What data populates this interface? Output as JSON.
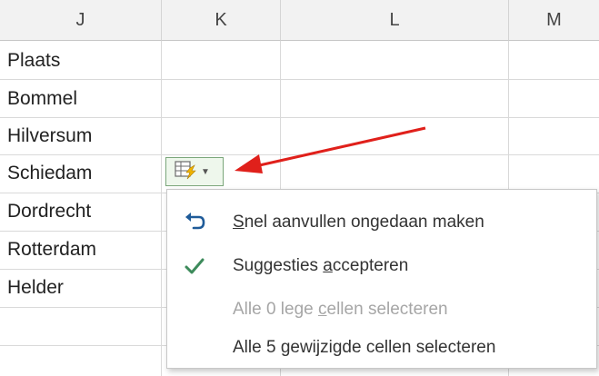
{
  "columns": [
    {
      "label": "J"
    },
    {
      "label": "K"
    },
    {
      "label": "L"
    },
    {
      "label": "M"
    }
  ],
  "column_j_values": [
    "Plaats",
    "Bommel",
    "Hilversum",
    "Schiedam",
    "Dordrecht",
    "Rotterdam",
    "Helder"
  ],
  "smart_tag": {
    "icon": "flash-fill-icon",
    "border_color": "#7aa67a"
  },
  "arrow": {
    "color": "#e0201b"
  },
  "menu": {
    "items": [
      {
        "prefix": "",
        "accel": "S",
        "suffix": "nel aanvullen ongedaan maken",
        "icon": "undo-arrow-icon",
        "enabled": true
      },
      {
        "prefix": "Suggesties ",
        "accel": "a",
        "suffix": "ccepteren",
        "icon": "checkmark-icon",
        "enabled": true
      },
      {
        "prefix": "Alle 0 lege ",
        "accel": "c",
        "suffix": "ellen selecteren",
        "icon": "",
        "enabled": false
      },
      {
        "prefix": "Alle 5 ",
        "accel": "g",
        "suffix": "ewijzigde cellen selecteren",
        "icon": "",
        "enabled": true
      }
    ]
  },
  "colors": {
    "header_bg": "#f2f2f2",
    "grid": "#d9d9d9",
    "accent_blue": "#1f5b99",
    "accent_green": "#3d8b5b"
  }
}
